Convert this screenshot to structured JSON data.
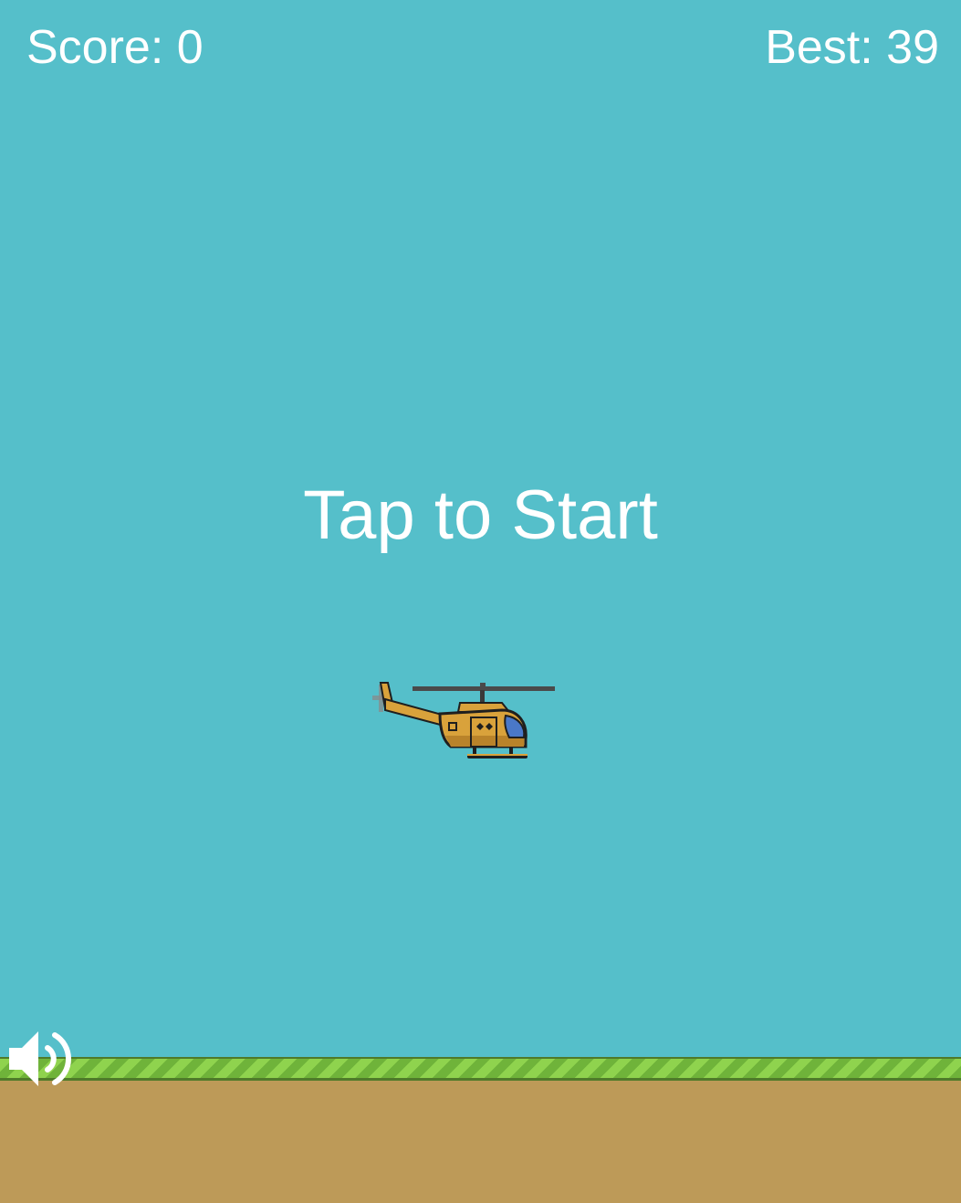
{
  "hud": {
    "score_text": "Score: 0",
    "best_text": "Best: 39",
    "score": 0,
    "best": 39
  },
  "prompt": {
    "text": "Tap to Start"
  },
  "player": {
    "sprite": "helicopter",
    "body_color": "#d9a23b",
    "window_color": "#4a78c8"
  },
  "sound": {
    "icon": "speaker-on-icon",
    "muted": false
  },
  "colors": {
    "sky": "#55bfca",
    "grass_light": "#8fd34e",
    "grass_dark": "#6fb33a",
    "dirt": "#bd9a58",
    "text": "#ffffff"
  }
}
